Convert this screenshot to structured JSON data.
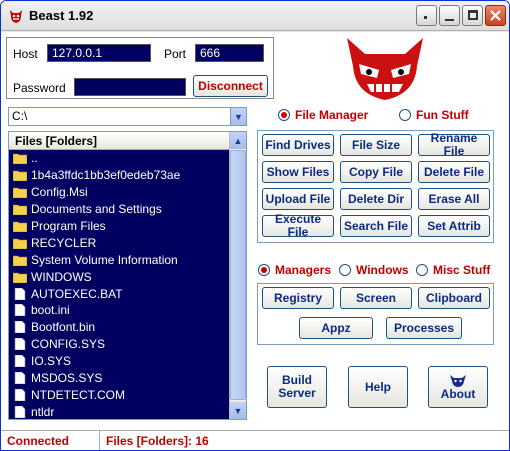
{
  "window": {
    "title": "Beast 1.92"
  },
  "connection": {
    "host_label": "Host",
    "host_value": "127.0.0.1",
    "port_label": "Port",
    "port_value": "666",
    "password_label": "Password",
    "password_value": "",
    "disconnect_label": "Disconnect"
  },
  "path": {
    "value": "C:\\"
  },
  "files": {
    "header": "Files [Folders]",
    "items": [
      {
        "name": "..",
        "kind": "folder"
      },
      {
        "name": "1b4a3ffdc1bb3ef0edeb73ae",
        "kind": "folder"
      },
      {
        "name": "Config.Msi",
        "kind": "folder"
      },
      {
        "name": "Documents and Settings",
        "kind": "folder"
      },
      {
        "name": "Program Files",
        "kind": "folder"
      },
      {
        "name": "RECYCLER",
        "kind": "folder"
      },
      {
        "name": "System Volume Information",
        "kind": "folder"
      },
      {
        "name": "WINDOWS",
        "kind": "folder"
      },
      {
        "name": "AUTOEXEC.BAT",
        "kind": "file"
      },
      {
        "name": "boot.ini",
        "kind": "file"
      },
      {
        "name": "Bootfont.bin",
        "kind": "file"
      },
      {
        "name": "CONFIG.SYS",
        "kind": "file"
      },
      {
        "name": "IO.SYS",
        "kind": "file"
      },
      {
        "name": "MSDOS.SYS",
        "kind": "file"
      },
      {
        "name": "NTDETECT.COM",
        "kind": "file"
      },
      {
        "name": "ntldr",
        "kind": "file"
      }
    ]
  },
  "mode": {
    "file_manager": "File Manager",
    "fun_stuff": "Fun Stuff",
    "selected": "file_manager"
  },
  "file_buttons": [
    "Find Drives",
    "File Size",
    "Rename File",
    "Show Files",
    "Copy File",
    "Delete File",
    "Upload File",
    "Delete Dir",
    "Erase All",
    "Execute File",
    "Search File",
    "Set Attrib"
  ],
  "tools_tabs": {
    "managers": "Managers",
    "windows": "Windows",
    "misc": "Misc Stuff",
    "selected": "managers"
  },
  "manager_buttons": [
    "Registry",
    "Screen",
    "Clipboard",
    "Appz",
    "Processes"
  ],
  "bottom_buttons": {
    "build": "Build\nServer",
    "help": "Help",
    "about": "About"
  },
  "status": {
    "state": "Connected",
    "count": "Files [Folders]: 16"
  },
  "colors": {
    "accent_red": "#c00000",
    "list_bg": "#000060",
    "button_text": "#0a2a84"
  }
}
